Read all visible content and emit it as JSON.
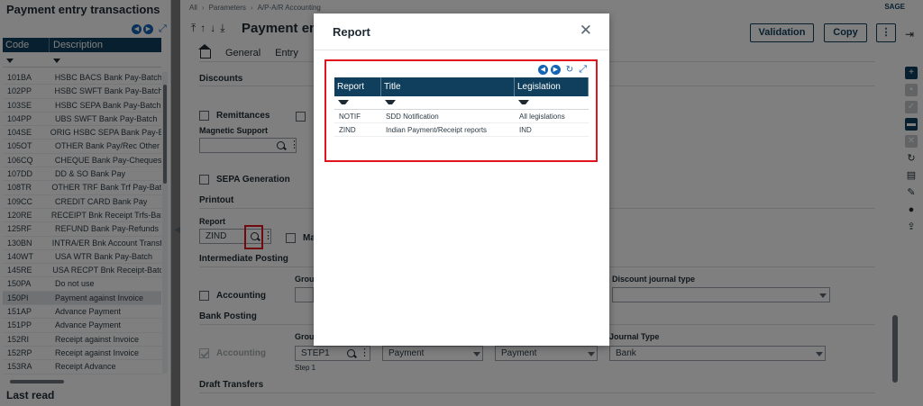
{
  "left_panel": {
    "title": "Payment entry transactions",
    "columns": [
      "Code",
      "Description"
    ],
    "rows": [
      {
        "code": "101BA",
        "desc": "HSBC BACS Bank Pay-Batch"
      },
      {
        "code": "102PP",
        "desc": "HSBC SWFT Bank Pay-Batch"
      },
      {
        "code": "103SE",
        "desc": "HSBC SEPA Bank Pay-Batch"
      },
      {
        "code": "104PP",
        "desc": "UBS SWFT Bank Pay-Batch"
      },
      {
        "code": "104SE",
        "desc": "ORIG HSBC SEPA Bank Pay-Batc"
      },
      {
        "code": "105OT",
        "desc": "OTHER Bank Pay/Rec Other"
      },
      {
        "code": "106CQ",
        "desc": "CHEQUE Bank Pay-Cheques"
      },
      {
        "code": "107DD",
        "desc": "DD & SO Bank Pay"
      },
      {
        "code": "108TR",
        "desc": "OTHER TRF Bank Trf Pay-Batch"
      },
      {
        "code": "109CC",
        "desc": "CREDIT CARD Bank Pay"
      },
      {
        "code": "120RE",
        "desc": "RECEIPT Bnk Receipt Trfs-Batch"
      },
      {
        "code": "125RF",
        "desc": "REFUND Bank Pay-Refunds"
      },
      {
        "code": "130BN",
        "desc": "INTRA/ER Bnk Account Transfer"
      },
      {
        "code": "140WT",
        "desc": "USA WTR Bank Pay-Batch"
      },
      {
        "code": "145RE",
        "desc": "USA RECPT Bnk Receipt-Batch"
      },
      {
        "code": "150PA",
        "desc": "Do not use"
      },
      {
        "code": "150PI",
        "desc": "Payment against Invoice"
      },
      {
        "code": "151AP",
        "desc": "Advance Payment"
      },
      {
        "code": "151PP",
        "desc": "Advance Payment"
      },
      {
        "code": "152RI",
        "desc": "Receipt against Invoice"
      },
      {
        "code": "152RP",
        "desc": "Receipt against Invoice"
      },
      {
        "code": "153RA",
        "desc": "Receipt Advance"
      }
    ],
    "selected_code": "150PI",
    "footer": "Last read"
  },
  "breadcrumb": [
    "All",
    "Parameters",
    "A/P-A/R Accounting"
  ],
  "brand": "SAGE",
  "page_title": "Payment entr",
  "tabs": [
    "General",
    "Entry"
  ],
  "buttons": {
    "validation": "Validation",
    "copy": "Copy"
  },
  "form": {
    "discounts": "Discounts",
    "remittances": "Remittances",
    "magnetic_support": "Magnetic Support",
    "sepa_generation": "SEPA Generation",
    "printout": "Printout",
    "report_label": "Report",
    "report_value": "ZIND",
    "ma_partial": "Ma",
    "intermediate_posting": "Intermediate Posting",
    "accounting": "Accounting",
    "group_partial": "Grou",
    "discount_journal_type": "Discount journal type",
    "bank_posting": "Bank Posting",
    "accounting2": "Accounting",
    "group2_partial": "Group",
    "journal_type": "Journal Type",
    "step_value": "STEP1",
    "step_label": "Step 1",
    "payment1": "Payment",
    "payment2": "Payment",
    "bank": "Bank",
    "draft_transfers": "Draft Transfers"
  },
  "dialog": {
    "title": "Report",
    "columns": [
      "Report",
      "Title",
      "Legislation"
    ],
    "rows": [
      {
        "report": "NOTIF",
        "title": "SDD Notification",
        "legislation": "All legislations"
      },
      {
        "report": "ZIND",
        "title": "Indian Payment/Receipt reports",
        "legislation": "IND"
      }
    ]
  },
  "colors": {
    "header_navy": "#0f3f5c",
    "accent_blue": "#1463b4",
    "highlight_red": "#e0141e"
  }
}
